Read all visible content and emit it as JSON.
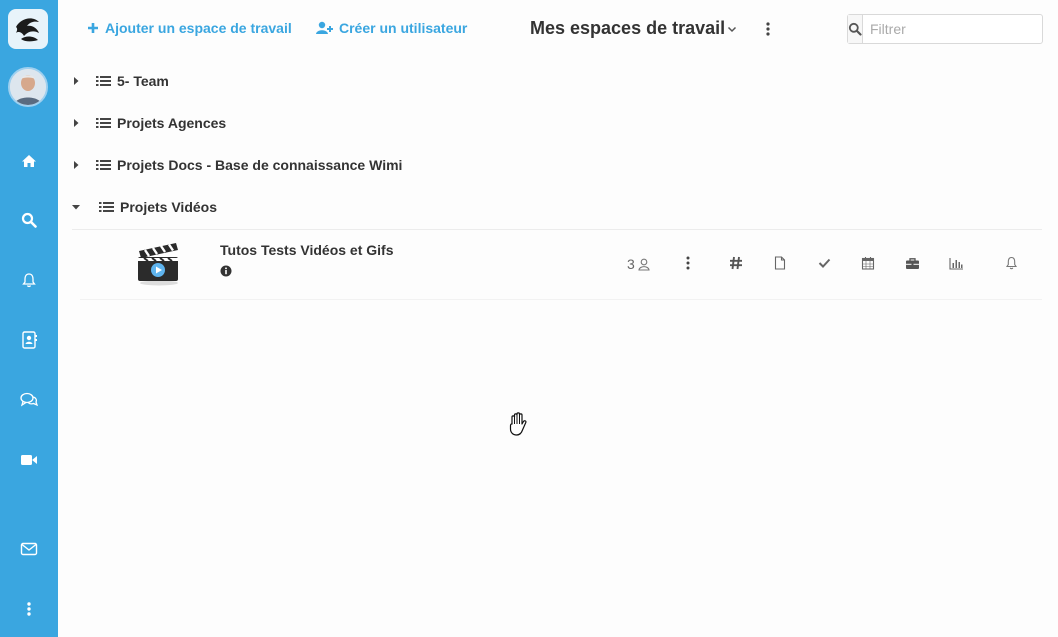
{
  "colors": {
    "sidebar": "#3aa6e0",
    "accent": "#3aa6e0",
    "text": "#333333"
  },
  "sidebar": {
    "logo": "wimi-logo",
    "avatar": "user-avatar",
    "icons": [
      "home-icon",
      "search-icon",
      "bell-icon",
      "contacts-icon",
      "chat-icon",
      "video-icon",
      "mail-icon",
      "more-icon"
    ]
  },
  "toolbar": {
    "add_workspace": "Ajouter un espace de travail",
    "create_user": "Créer un utilisateur",
    "title": "Mes espaces de travail",
    "filter_placeholder": "Filtrer"
  },
  "workspaces": [
    {
      "label": "5- Team",
      "expanded": false
    },
    {
      "label": "Projets Agences",
      "expanded": false
    },
    {
      "label": "Projets Docs - Base de connaissance Wimi",
      "expanded": false
    },
    {
      "label": "Projets Vidéos",
      "expanded": true
    }
  ],
  "project": {
    "name": "Tutos Tests Vidéos et Gifs",
    "members": "3",
    "actions": [
      "more-icon",
      "channels-icon",
      "documents-icon",
      "tasks-icon",
      "calendar-icon",
      "briefcase-icon",
      "stats-icon",
      "notifications-icon"
    ]
  }
}
